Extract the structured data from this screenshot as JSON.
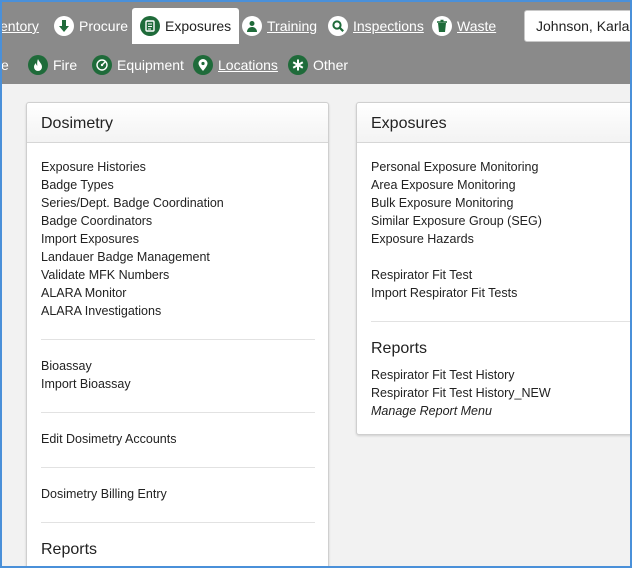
{
  "nav": {
    "row1": [
      {
        "label": "entory",
        "icon": "inventory-icon",
        "underline": true
      },
      {
        "label": "Procure",
        "icon": "download-arrow-icon",
        "underline": false
      },
      {
        "label": "Exposures",
        "icon": "clipboard-icon",
        "underline": false,
        "active": true
      },
      {
        "label": "Training",
        "icon": "person-icon",
        "underline": true
      },
      {
        "label": "Inspections",
        "icon": "magnifier-icon",
        "underline": true
      },
      {
        "label": "Waste",
        "icon": "trash-icon",
        "underline": true
      }
    ],
    "row2": [
      {
        "label": "e",
        "icon": "",
        "underline": false
      },
      {
        "label": "Fire",
        "icon": "flame-icon",
        "underline": false
      },
      {
        "label": "Equipment",
        "icon": "gauge-icon",
        "underline": false
      },
      {
        "label": "Locations",
        "icon": "map-pin-icon",
        "underline": true
      },
      {
        "label": "Other",
        "icon": "asterisk-icon",
        "underline": false
      }
    ],
    "user": "Johnson, Karla"
  },
  "dosimetry": {
    "title": "Dosimetry",
    "group1": [
      "Exposure Histories",
      "Badge Types",
      "Series/Dept. Badge Coordination",
      "Badge Coordinators",
      "Import Exposures",
      "Landauer Badge Management",
      "Validate MFK Numbers",
      "ALARA Monitor",
      "ALARA Investigations"
    ],
    "group2": [
      "Bioassay",
      "Import Bioassay"
    ],
    "group3": [
      "Edit Dosimetry Accounts"
    ],
    "group4": [
      "Dosimetry Billing Entry"
    ],
    "reports_title": "Reports"
  },
  "exposures": {
    "title": "Exposures",
    "group1": [
      "Personal Exposure Monitoring",
      "Area Exposure Monitoring",
      "Bulk Exposure Monitoring",
      "Similar Exposure Group (SEG)",
      "Exposure Hazards"
    ],
    "group2": [
      "Respirator Fit Test",
      "Import Respirator Fit Tests"
    ],
    "reports_title": "Reports",
    "reports": [
      "Respirator Fit Test History",
      "Respirator Fit Test History_NEW"
    ],
    "manage": "Manage Report Menu"
  },
  "colors": {
    "nav_bg": "#8a8a8a",
    "frame_border": "#4a90d9",
    "icon_green": "#1f6b3a"
  }
}
